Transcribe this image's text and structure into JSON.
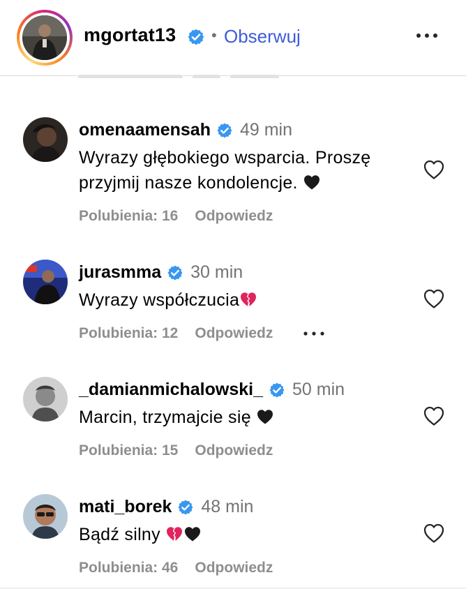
{
  "header": {
    "username": "mgortat13",
    "separator": "•",
    "follow_label": "Obserwuj",
    "verified_icon": "verified-badge-icon",
    "more_icon": "more-horizontal-icon"
  },
  "colors": {
    "verified": "#3897f0",
    "link": "#3e5bd9",
    "meta_text": "#8e8e8e",
    "time_text": "#737373"
  },
  "comments": [
    {
      "username": "omenaamensah",
      "time": "49 min",
      "text_line1": "Wyrazy głębokiego wsparcia. Proszę",
      "text_line2": "przyjmij nasze kondolencje.",
      "emojis": [
        "black-heart"
      ],
      "likes_label": "Polubienia: 16",
      "reply_label": "Odpowiedz"
    },
    {
      "username": "jurasmma",
      "time": "30 min",
      "text": "Wyrazy współczucia",
      "emojis": [
        "broken-heart"
      ],
      "likes_label": "Polubienia: 12",
      "reply_label": "Odpowiedz",
      "has_more_menu": true
    },
    {
      "username": "_damianmichalowski_",
      "time": "50 min",
      "text": "Marcin, trzymajcie się",
      "emojis": [
        "black-heart"
      ],
      "likes_label": "Polubienia: 15",
      "reply_label": "Odpowiedz"
    },
    {
      "username": "mati_borek",
      "time": "48 min",
      "text": "Bądź silny",
      "emojis": [
        "broken-heart",
        "black-heart"
      ],
      "likes_label": "Polubienia: 46",
      "reply_label": "Odpowiedz"
    }
  ]
}
